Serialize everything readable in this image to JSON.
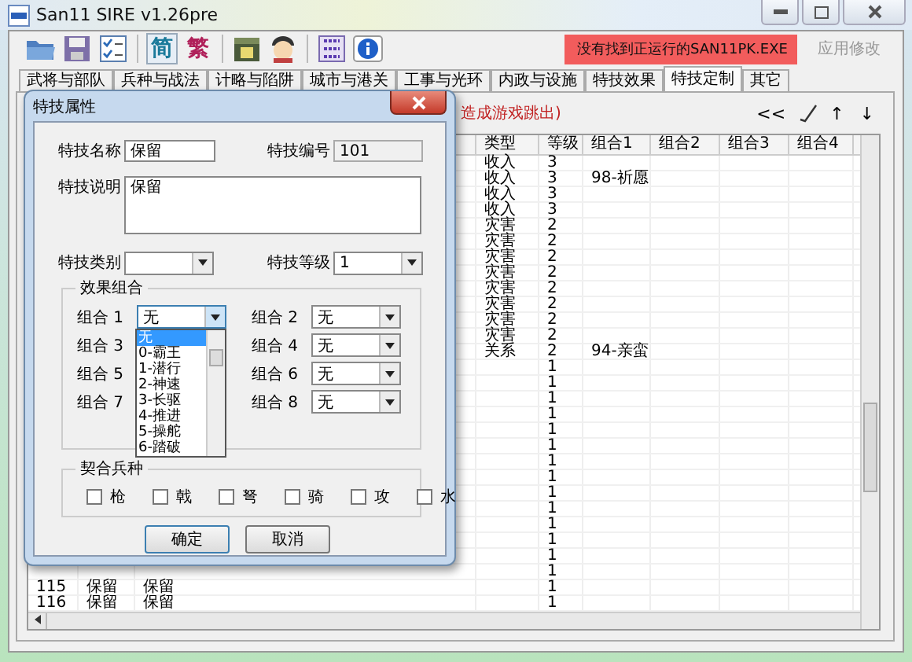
{
  "window": {
    "title": "San11 SIRE v1.26pre"
  },
  "toolbar": [
    {
      "kind": "open"
    },
    {
      "kind": "save"
    },
    {
      "kind": "checklist"
    },
    {
      "kind": "separator"
    },
    {
      "kind": "text",
      "label": "简",
      "selected": true
    },
    {
      "kind": "text",
      "label": "繁",
      "selected": false
    },
    {
      "kind": "separator"
    },
    {
      "kind": "calendar"
    },
    {
      "kind": "person"
    },
    {
      "kind": "separator"
    },
    {
      "kind": "binary"
    },
    {
      "kind": "info"
    }
  ],
  "status_message": "没有找到正运行的SAN11PK.EXE",
  "apply_button": {
    "label": "应用修改",
    "disabled": true
  },
  "tabs": [
    {
      "label": "武将与部队",
      "selected": false
    },
    {
      "label": "兵种与战法",
      "selected": false
    },
    {
      "label": "计略与陷阱",
      "selected": false
    },
    {
      "label": "城市与港关",
      "selected": false
    },
    {
      "label": "工事与光环",
      "selected": false
    },
    {
      "label": "内政与设施",
      "selected": false
    },
    {
      "label": "特技效果",
      "selected": false
    },
    {
      "label": "特技定制",
      "selected": true
    },
    {
      "label": "其它",
      "selected": false
    }
  ],
  "notice": "造成游戏跳出)",
  "nav": {
    "first": "<<",
    "up": "↑",
    "down": "↓"
  },
  "table": {
    "columns": [
      "类型",
      "等级",
      "组合1",
      "组合2",
      "组合3",
      "组合4"
    ],
    "rows": [
      {
        "type": "收入",
        "level": "3"
      },
      {
        "type": "收入",
        "level": "3",
        "combo_1": "98-祈愿"
      },
      {
        "type": "收入",
        "level": "3"
      },
      {
        "type": "收入",
        "level": "3"
      },
      {
        "type": "灾害",
        "level": "2"
      },
      {
        "type": "灾害",
        "level": "2"
      },
      {
        "type": "灾害",
        "level": "2"
      },
      {
        "type": "灾害",
        "level": "2"
      },
      {
        "type": "灾害",
        "level": "2"
      },
      {
        "type": "灾害",
        "level": "2"
      },
      {
        "type": "灾害",
        "level": "2"
      },
      {
        "type": "灾害",
        "level": "2"
      },
      {
        "type": "关系",
        "level": "2",
        "combo_1": "94-亲蛮"
      },
      {
        "level": "1"
      },
      {
        "level": "1"
      },
      {
        "level": "1"
      },
      {
        "level": "1"
      },
      {
        "level": "1"
      },
      {
        "level": "1"
      },
      {
        "level": "1"
      },
      {
        "level": "1"
      },
      {
        "level": "1"
      },
      {
        "level": "1"
      },
      {
        "level": "1"
      },
      {
        "level": "1"
      },
      {
        "level": "1"
      },
      {
        "level": "1"
      },
      {
        "id": "115",
        "name": "保留",
        "column_3": "保留",
        "level": "1"
      },
      {
        "id": "116",
        "name": "保留",
        "column_3": "保留",
        "level": "1"
      }
    ]
  },
  "dialog": {
    "title": "特技属性",
    "name_label": "特技名称",
    "name_value": "保留",
    "number_label": "特技编号",
    "number_value": "101",
    "desc_label": "特技说明",
    "desc_value": "保留",
    "category_label": "特技类别",
    "grade_label": "特技等级",
    "grade_value": "1",
    "effects_title": "效果组合",
    "combos": [
      {
        "label": "组合 1",
        "value": "无",
        "open": true
      },
      {
        "label": "组合 2",
        "value": "无",
        "open": false
      },
      {
        "label": "组合 3",
        "open": false
      },
      {
        "label": "组合 4",
        "value": "无",
        "open": false
      },
      {
        "label": "组合 5",
        "open": false
      },
      {
        "label": "组合 6",
        "value": "无",
        "open": false
      },
      {
        "label": "组合 7",
        "open": false
      },
      {
        "label": "组合 8",
        "value": "无",
        "open": false
      }
    ],
    "dropdown_options": [
      {
        "label": "无",
        "selected": true
      },
      {
        "label": "0-霸王",
        "selected": false
      },
      {
        "label": "1-潜行",
        "selected": false
      },
      {
        "label": "2-神速",
        "selected": false
      },
      {
        "label": "3-长驱",
        "selected": false
      },
      {
        "label": "4-推进",
        "selected": false
      },
      {
        "label": "5-操舵",
        "selected": false
      },
      {
        "label": "6-踏破",
        "selected": false
      }
    ],
    "units_title": "契合兵种",
    "units": [
      {
        "label": "枪",
        "checked": false
      },
      {
        "label": "戟",
        "checked": false
      },
      {
        "label": "弩",
        "checked": false
      },
      {
        "label": "骑",
        "checked": false
      },
      {
        "label": "攻",
        "checked": false
      },
      {
        "label": "水",
        "checked": false
      }
    ],
    "buttons": [
      "确定",
      "取消"
    ]
  }
}
